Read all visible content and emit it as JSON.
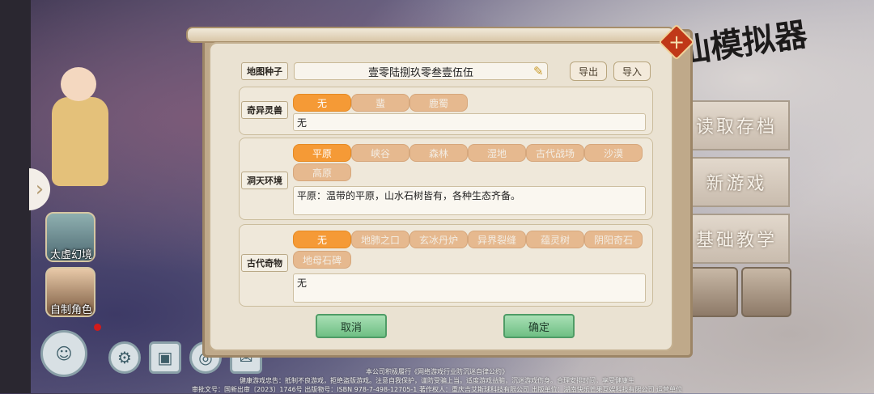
{
  "background": {
    "side_items": [
      {
        "label": "太虚幻境",
        "icon": "landscape-icon"
      },
      {
        "label": "自制角色",
        "icon": "character-icon"
      }
    ],
    "menu": {
      "load": "读取存档",
      "new_game": "新游戏",
      "tutorial": "基础教学"
    },
    "footer_lines": [
      "本公司积极履行《网络游戏行业防沉迷自律公约》",
      "健康游戏忠告：抵制不良游戏，拒绝盗版游戏。注意自我保护，谨防受骗上当。适度游戏益脑，沉迷游戏伤身。合理安排时间，享受健康生",
      "审批文号：国新出审〔2023〕1746号 出版物号：ISBN 978-7-498-12705-1 著作权人：重庆吉艾斯球科技有限公司 出版单位：湖南快乐芒果互娱科技有限公司 运营单位"
    ]
  },
  "dialog": {
    "seed": {
      "label": "地图种子",
      "value": "壹零陆捌玖零叁壹伍伍",
      "export": "导出",
      "import": "导入"
    },
    "beast": {
      "label": "奇异灵兽",
      "options": [
        "无",
        "蜚",
        "鹿蜀"
      ],
      "selected": 0,
      "description": "无"
    },
    "environment": {
      "label": "洞天环境",
      "options": [
        "平原",
        "峡谷",
        "森林",
        "湿地",
        "古代战场",
        "沙漠",
        "高原"
      ],
      "selected": 0,
      "description": "平原：温带的平原，山水石树皆有，各种生态齐备。"
    },
    "relic": {
      "label": "古代奇物",
      "options": [
        "无",
        "地肺之口",
        "玄冰丹炉",
        "异界裂缝",
        "蕴灵树",
        "阴阳奇石",
        "地母石碑"
      ],
      "selected": 0,
      "description": "无"
    },
    "cancel": "取消",
    "confirm": "确定"
  },
  "colors": {
    "chip_selected": "#f59a36",
    "chip_normal": "#e6b98f",
    "button_green": "#6fbf84",
    "close_red": "#c03818"
  }
}
